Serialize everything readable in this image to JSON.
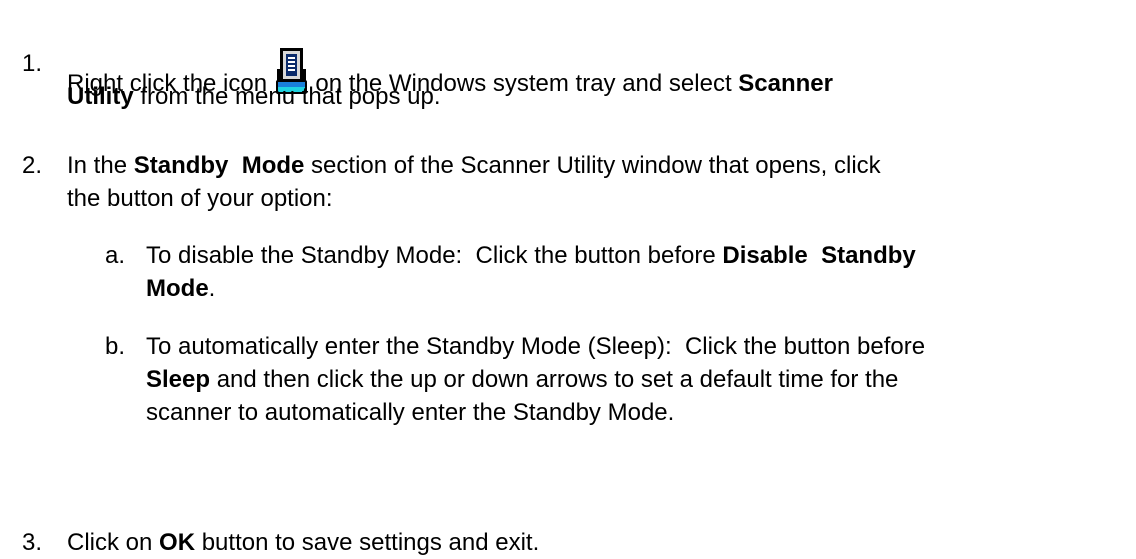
{
  "steps": [
    {
      "number": "1.",
      "line1": {
        "before_icon": "Right click the icon ",
        "after_icon": " on the Windows system tray and select ",
        "bold": "Scanner"
      },
      "line2": {
        "bold": "Utility",
        "rest": " from the menu that pops up."
      },
      "icon": "scanner-tray-icon"
    },
    {
      "number": "2.",
      "line1": {
        "before": "In the ",
        "bold": "Standby  Mode",
        "after": " section of the Scanner Utility window that opens, click"
      },
      "line2": "the button of your option:",
      "substeps": [
        {
          "letter": "a.",
          "line1": {
            "before": "To disable the Standby Mode:  Click the button before ",
            "bold": "Disable  Standby"
          },
          "line2": {
            "bold": "Mode",
            "after": "."
          }
        },
        {
          "letter": "b.",
          "line1": "To automatically enter the Standby Mode (Sleep):  Click the button before",
          "line2": {
            "bold": "Sleep",
            "after": " and then click the up or down arrows to set a default time for the"
          },
          "line3": "scanner to automatically enter the Standby Mode."
        }
      ]
    },
    {
      "number": "3.",
      "line1": {
        "before": "Click on ",
        "bold": "OK",
        "after": " button to save settings and exit."
      }
    }
  ]
}
